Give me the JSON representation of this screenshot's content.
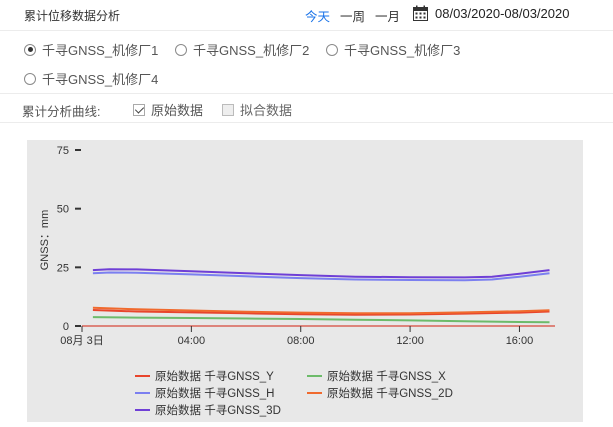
{
  "header": {
    "title": "累计位移数据分析",
    "ranges": [
      "今天",
      "一周",
      "一月"
    ],
    "active_range": "今天",
    "date_range": "08/03/2020-08/03/2020",
    "accent_color": "#1a73e8"
  },
  "stations": {
    "items": [
      "千寻GNSS_机修厂1",
      "千寻GNSS_机修厂2",
      "千寻GNSS_机修厂3",
      "千寻GNSS_机修厂4"
    ],
    "selected": "千寻GNSS_机修厂1"
  },
  "curves": {
    "label": "累计分析曲线:",
    "options": [
      {
        "label": "原始数据",
        "checked": true
      },
      {
        "label": "拟合数据",
        "checked": false
      }
    ]
  },
  "chart_data": {
    "type": "line",
    "ylabel": "GNSS：mm",
    "ylim": [
      0,
      75
    ],
    "yticks": [
      0,
      25,
      50,
      75
    ],
    "xlim": [
      0,
      17.3
    ],
    "xticks": [
      {
        "x": 0,
        "label": "08月 3日"
      },
      {
        "x": 4,
        "label": "04:00"
      },
      {
        "x": 8,
        "label": "08:00"
      },
      {
        "x": 12,
        "label": "12:00"
      },
      {
        "x": 16,
        "label": "16:00"
      }
    ],
    "legend_position": "bottom",
    "grid": false,
    "series": [
      {
        "name": "原始数据 千寻GNSS_Y",
        "color": "#e8452c",
        "x": [
          0.4,
          2,
          4,
          6,
          8,
          10,
          12,
          14,
          16,
          17.1
        ],
        "y": [
          6.8,
          6.2,
          5.8,
          5.4,
          5.0,
          4.8,
          4.9,
          5.3,
          5.7,
          6.2
        ]
      },
      {
        "name": "原始数据 千寻GNSS_X",
        "color": "#6dbb6a",
        "x": [
          0.4,
          2,
          4,
          6,
          8,
          10,
          12,
          14,
          16,
          17.1
        ],
        "y": [
          3.8,
          3.6,
          3.4,
          3.2,
          3.0,
          2.7,
          2.4,
          2.0,
          1.7,
          1.6
        ]
      },
      {
        "name": "原始数据 千寻GNSS_H",
        "color": "#7b7ff0",
        "x": [
          0.4,
          1,
          2,
          4,
          6,
          8,
          10,
          12,
          14,
          15,
          16,
          17.1
        ],
        "y": [
          22.5,
          22.8,
          22.7,
          22.0,
          21.2,
          20.4,
          19.8,
          19.6,
          19.5,
          19.8,
          21.0,
          22.5
        ]
      },
      {
        "name": "原始数据 千寻GNSS_2D",
        "color": "#f06a2e",
        "x": [
          0.4,
          2,
          4,
          6,
          8,
          10,
          12,
          14,
          16,
          17.1
        ],
        "y": [
          7.8,
          7.1,
          6.6,
          6.1,
          5.7,
          5.4,
          5.4,
          5.8,
          6.3,
          6.7
        ]
      },
      {
        "name": "原始数据 千寻GNSS_3D",
        "color": "#6f3fd6",
        "x": [
          0.4,
          1,
          2,
          4,
          6,
          8,
          10,
          12,
          14,
          15,
          16,
          17.1
        ],
        "y": [
          23.8,
          24.2,
          24.1,
          23.3,
          22.5,
          21.7,
          21.0,
          20.8,
          20.7,
          21.0,
          22.3,
          23.8
        ]
      }
    ]
  }
}
